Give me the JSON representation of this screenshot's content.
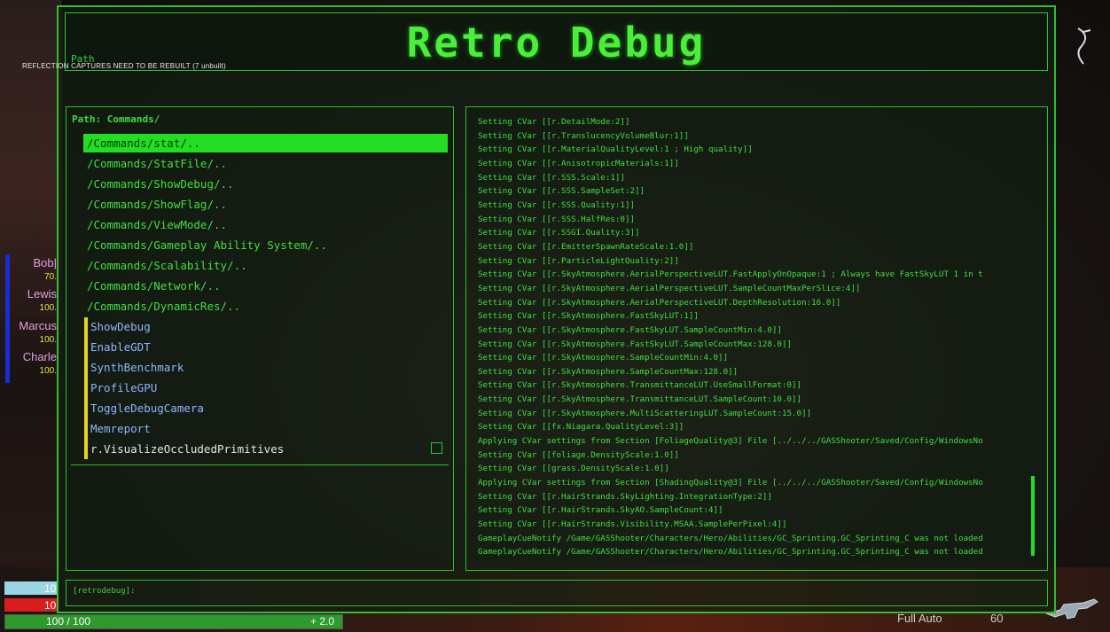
{
  "hud": {
    "reflection_warning": "REFLECTION CAPTURES NEED TO BE REBUILT (7 unbuilt)",
    "party": [
      {
        "name": "Bob|",
        "value": "70."
      },
      {
        "name": "Lewis",
        "value": "100."
      },
      {
        "name": "Marcus",
        "value": "100."
      },
      {
        "name": "Charle",
        "value": "100."
      }
    ],
    "cyan_bar_value": "10",
    "red_bar_value": "10",
    "health_text": "100 / 100",
    "health_fraction": 1.0,
    "health_regen": "+ 2.0",
    "fire_mode": "Full Auto",
    "ammo": "60"
  },
  "debug": {
    "title": "Retro Debug",
    "title_path_label": "Path",
    "path_header": "Path: Commands/",
    "commands": [
      "/Commands/stat/..",
      "/Commands/StatFile/..",
      "/Commands/ShowDebug/..",
      "/Commands/ShowFlag/..",
      "/Commands/ViewMode/..",
      "/Commands/Gameplay Ability System/..",
      "/Commands/Scalability/..",
      "/Commands/Network/..",
      "/Commands/DynamicRes/.."
    ],
    "favorites": [
      "ShowDebug",
      "EnableGDT",
      "SynthBenchmark",
      "ProfileGPU",
      "ToggleDebugCamera",
      "Memreport",
      "r.VisualizeOccludedPrimitives"
    ],
    "log": [
      "Setting CVar [[r.DetailMode:2]]",
      "Setting CVar [[r.TranslucencyVolumeBlur:1]]",
      "Setting CVar [[r.MaterialQualityLevel:1 ; High quality]]",
      "Setting CVar [[r.AnisotropicMaterials:1]]",
      "Setting CVar [[r.SSS.Scale:1]]",
      "Setting CVar [[r.SSS.SampleSet:2]]",
      "Setting CVar [[r.SSS.Quality:1]]",
      "Setting CVar [[r.SSS.HalfRes:0]]",
      "Setting CVar [[r.SSGI.Quality:3]]",
      "Setting CVar [[r.EmitterSpawnRateScale:1.0]]",
      "Setting CVar [[r.ParticleLightQuality:2]]",
      "Setting CVar [[r.SkyAtmosphere.AerialPerspectiveLUT.FastApplyOnOpaque:1 ; Always have FastSkyLUT 1 in t",
      "Setting CVar [[r.SkyAtmosphere.AerialPerspectiveLUT.SampleCountMaxPerSlice:4]]",
      "Setting CVar [[r.SkyAtmosphere.AerialPerspectiveLUT.DepthResolution:16.0]]",
      "Setting CVar [[r.SkyAtmosphere.FastSkyLUT:1]]",
      "Setting CVar [[r.SkyAtmosphere.FastSkyLUT.SampleCountMin:4.0]]",
      "Setting CVar [[r.SkyAtmosphere.FastSkyLUT.SampleCountMax:128.0]]",
      "Setting CVar [[r.SkyAtmosphere.SampleCountMin:4.0]]",
      "Setting CVar [[r.SkyAtmosphere.SampleCountMax:128.0]]",
      "Setting CVar [[r.SkyAtmosphere.TransmittanceLUT.UseSmallFormat:0]]",
      "Setting CVar [[r.SkyAtmosphere.TransmittanceLUT.SampleCount:10.0]]",
      "Setting CVar [[r.SkyAtmosphere.MultiScatteringLUT.SampleCount:15.0]]",
      "Setting CVar [[fx.Niagara.QualityLevel:3]]",
      "Applying CVar settings from Section [FoliageQuality@3] File [../../../GASShooter/Saved/Config/WindowsNo",
      "Setting CVar [[foliage.DensityScale:1.0]]",
      "Setting CVar [[grass.DensityScale:1.0]]",
      "Applying CVar settings from Section [ShadingQuality@3] File [../../../GASShooter/Saved/Config/WindowsNo",
      "Setting CVar [[r.HairStrands.SkyLighting.IntegrationType:2]]",
      "Setting CVar [[r.HairStrands.SkyAO.SampleCount:4]]",
      "Setting CVar [[r.HairStrands.Visibility.MSAA.SamplePerPixel:4]]",
      "GameplayCueNotify /Game/GASShooter/Characters/Hero/Abilities/GC_Sprinting.GC_Sprinting_C was not loaded",
      "GameplayCueNotify /Game/GASShooter/Characters/Hero/Abilities/GC_Sprinting.GC_Sprinting_C was not loaded"
    ],
    "console_prompt": "[retrodebug]:",
    "colors": {
      "accent": "#2fbf2f",
      "selected": "#22dd22",
      "favorite_bar": "#e6d21f",
      "favorite_text": "#8ab8ff"
    }
  }
}
